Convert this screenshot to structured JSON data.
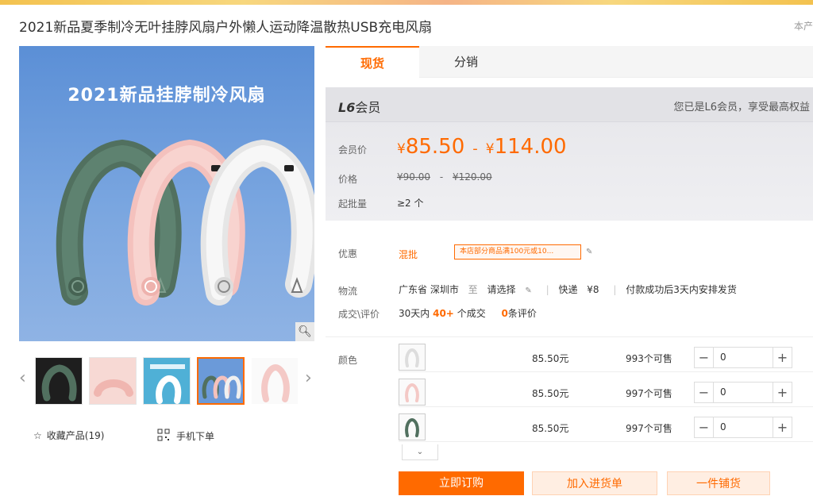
{
  "page": {
    "title": "2021新品夏季制冷无叶挂脖风扇户外懒人运动降温散热USB充电风扇",
    "title_right": "本产"
  },
  "gallery": {
    "main_heading": "2021新品挂脖制冷风扇",
    "zoom_icon": "search-icon",
    "thumb_count": 5,
    "active_thumb": 4,
    "collect_label": "收藏产品(19)",
    "mobile_label": "手机下单"
  },
  "tabs": [
    {
      "label": "现货",
      "active": true
    },
    {
      "label": "分销",
      "active": false
    }
  ],
  "member": {
    "level_badge": "L6",
    "level_suffix": "会员",
    "note": "您已是L6会员，享受最高权益"
  },
  "pricing": {
    "member_price_label": "会员价",
    "currency": "¥",
    "low": "85.50",
    "separator": "-",
    "high": "114.00",
    "original_label": "价格",
    "original_low": "¥90.00",
    "original_sep": "-",
    "original_high": "¥120.00",
    "moq_label": "起批量",
    "moq_value": "≥2 个"
  },
  "promo": {
    "label": "优惠",
    "tag": "混批",
    "coupon": "本店部分商品满100元或10..."
  },
  "logistics": {
    "label": "物流",
    "from": "广东省 深圳市",
    "to_word": "至",
    "dest": "请选择",
    "method": "快递",
    "fee": "¥8",
    "ship_note": "付款成功后3天内安排发货"
  },
  "deals": {
    "label": "成交\\评价",
    "prefix": "30天内",
    "count": "40+",
    "suffix": "个成交",
    "reviews": "0",
    "reviews_suffix": "条评价"
  },
  "sku": {
    "label": "颜色",
    "rows": [
      {
        "price": "85.50元",
        "stock": "993个可售",
        "qty": "0",
        "color": "#f2f2f2"
      },
      {
        "price": "85.50元",
        "stock": "997个可售",
        "qty": "0",
        "color": "#f4c9c6"
      },
      {
        "price": "85.50元",
        "stock": "997个可售",
        "qty": "0",
        "color": "#51705f"
      }
    ]
  },
  "actions": {
    "buy": "立即订购",
    "cart": "加入进货单",
    "shop": "一件铺货"
  },
  "colors": {
    "accent": "#ff6a00",
    "fan_green": "#51705f",
    "fan_pink": "#f4c1bd",
    "fan_white": "#f0f0f0",
    "image_bg": "#6b9ad9"
  }
}
